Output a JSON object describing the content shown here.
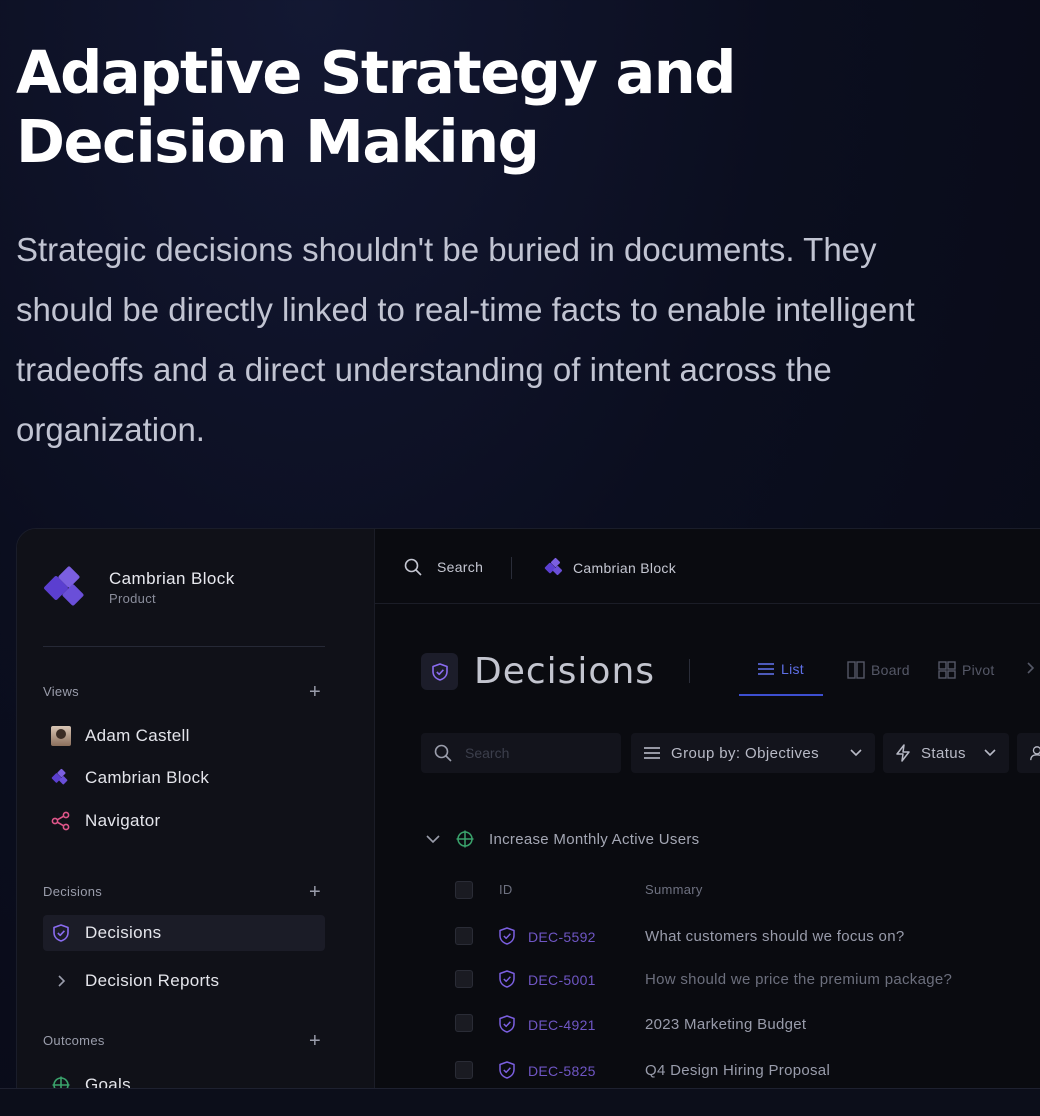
{
  "hero": {
    "title": "Adaptive Strategy and Decision Making",
    "description": "Strategic decisions shouldn't be buried in documents. They should be directly linked to real-time facts to enable intelligent tradeoffs and a direct understanding of intent across the organization."
  },
  "app": {
    "workspace": {
      "name": "Cambrian Block",
      "subtitle": "Product"
    },
    "sidebar": {
      "views_label": "Views",
      "views": [
        {
          "label": "Adam Castell",
          "icon": "avatar"
        },
        {
          "label": "Cambrian Block",
          "icon": "cambrian-logo-icon"
        },
        {
          "label": "Navigator",
          "icon": "share-nodes-icon"
        }
      ],
      "decisions_label": "Decisions",
      "decisions": [
        {
          "label": "Decisions",
          "icon": "shield-check-icon",
          "active": true
        },
        {
          "label": "Decision Reports",
          "icon": "chevron-right-icon"
        }
      ],
      "outcomes_label": "Outcomes",
      "outcomes": [
        {
          "label": "Goals",
          "icon": "crosshair-icon"
        }
      ],
      "plus": "+"
    },
    "topbar": {
      "search_label": "Search",
      "workspace_label": "Cambrian Block"
    },
    "page": {
      "title": "Decisions",
      "tabs": [
        {
          "label": "List",
          "active": true
        },
        {
          "label": "Board"
        },
        {
          "label": "Pivot"
        }
      ],
      "search_placeholder": "Search",
      "group_by": "Group by: Objectives",
      "status_filter": "Status"
    },
    "group": {
      "name": "Increase Monthly Active Users"
    },
    "table": {
      "columns": [
        "ID",
        "Summary"
      ],
      "rows": [
        {
          "id": "DEC-5592",
          "summary": "What customers should we focus on?"
        },
        {
          "id": "DEC-5001",
          "summary": "How should we price the premium package?"
        },
        {
          "id": "DEC-4921",
          "summary": "2023 Marketing Budget"
        },
        {
          "id": "DEC-5825",
          "summary": "Q4 Design Hiring Proposal"
        }
      ]
    }
  },
  "colors": {
    "accent_purple": "#7b5fe0",
    "accent_blue": "#3d4fd1",
    "goal_green": "#3aa36c",
    "navigator_pink": "#e0568a"
  }
}
